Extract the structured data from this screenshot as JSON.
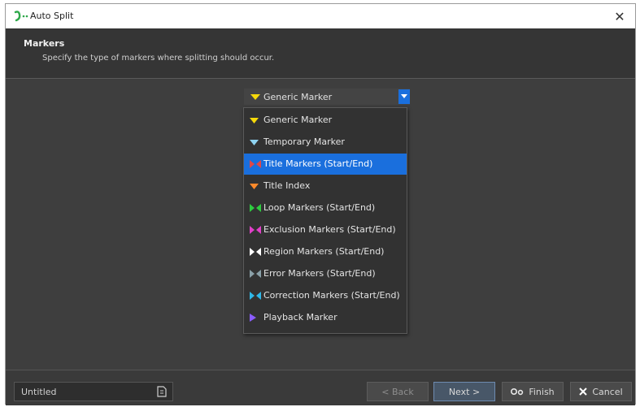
{
  "window": {
    "title": "Auto Split",
    "close_glyph": "✕"
  },
  "header": {
    "title": "Markers",
    "subtitle": "Specify the type of markers where splitting should occur."
  },
  "combo": {
    "selected_label": "Generic Marker",
    "selected_marker_color": "#f5d90a"
  },
  "dropdown": {
    "items": [
      {
        "label": "Generic Marker",
        "icon": "marker-down-triangle",
        "color": "#f5d90a",
        "selected": false
      },
      {
        "label": "Temporary Marker",
        "icon": "marker-down-triangle",
        "color": "#8fd3f0",
        "selected": false
      },
      {
        "label": "Title Markers (Start/End)",
        "icon": "marker-start-end",
        "color": "#e04848",
        "selected": true
      },
      {
        "label": "Title Index",
        "icon": "marker-down-triangle",
        "color": "#ff8a2a",
        "selected": false
      },
      {
        "label": "Loop Markers (Start/End)",
        "icon": "marker-start-end",
        "color": "#2ecc40",
        "selected": false
      },
      {
        "label": "Exclusion Markers (Start/End)",
        "icon": "marker-start-end",
        "color": "#e040c8",
        "selected": false
      },
      {
        "label": "Region Markers (Start/End)",
        "icon": "marker-start-end",
        "color": "#ffffff",
        "selected": false
      },
      {
        "label": "Error Markers (Start/End)",
        "icon": "marker-start-end",
        "color": "#8aa0a8",
        "selected": false
      },
      {
        "label": "Correction Markers (Start/End)",
        "icon": "marker-start-end",
        "color": "#2fb8e8",
        "selected": false
      },
      {
        "label": "Playback Marker",
        "icon": "marker-right-triangle",
        "color": "#8a5cff",
        "selected": false
      }
    ]
  },
  "footer": {
    "name_value": "Untitled",
    "back_label": "< Back",
    "next_label": "Next >",
    "finish_label": "Finish",
    "cancel_label": "Cancel"
  },
  "colors": {
    "accent": "#1a6fdd",
    "background": "#3e3e3e",
    "app_icon": "#2ea84a"
  }
}
